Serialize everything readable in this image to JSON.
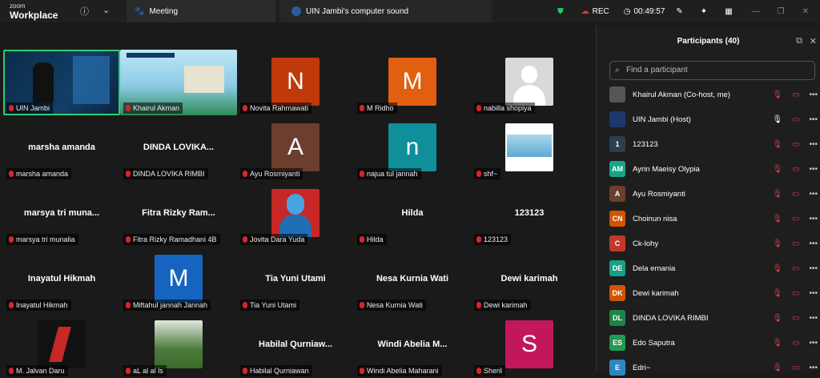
{
  "topbar": {
    "brand_small": "zoom",
    "brand_large": "Workplace",
    "meeting_tab": "Meeting",
    "sound_tab": "UIN Jambi's computer sound",
    "rec_label": "REC",
    "timer": "00:49:57"
  },
  "tiles": [
    {
      "name": "UIN Jambi",
      "type": "video",
      "label": "UIN Jambi"
    },
    {
      "name": "Khairul Akman",
      "type": "slide",
      "label": "Khairul Akman"
    },
    {
      "name": "Novita Rahmawati",
      "type": "avatar",
      "initial": "N",
      "color": "#c0390b",
      "label": "Novita Rahmawati"
    },
    {
      "name": "M Ridho",
      "type": "avatar",
      "initial": "M",
      "color": "#e06010",
      "label": "M Ridho"
    },
    {
      "name": "nabilla shopiya",
      "type": "photo",
      "label": "nabilla shopiya"
    },
    {
      "name": "marsha amanda",
      "type": "name",
      "label": "marsha amanda"
    },
    {
      "name": "DINDA LOVIKA...",
      "type": "name",
      "label": "DINDA LOVIKA RIMBI"
    },
    {
      "name": "Ayu Rosmiyanti",
      "type": "avatar",
      "initial": "A",
      "color": "#6b3e2e",
      "label": "Ayu Rosmiyanti"
    },
    {
      "name": "najua tul jannah",
      "type": "avatar",
      "initial": "n",
      "color": "#0e8f9a",
      "label": "najua tul jannah"
    },
    {
      "name": "shf~",
      "type": "slide2",
      "label": "shf~"
    },
    {
      "name": "marsya tri muna...",
      "type": "name",
      "label": "marsya tri munalia"
    },
    {
      "name": "Fitra Rizky Ram...",
      "type": "name",
      "label": "Fitra Rizky Ramadhani 4B"
    },
    {
      "name": "Jovita Dara Yuda",
      "type": "person",
      "label": "Jovita Dara Yuda"
    },
    {
      "name": "Hilda",
      "type": "name",
      "label": "Hilda"
    },
    {
      "name": "123123",
      "type": "name",
      "label": "123123"
    },
    {
      "name": "Inayatul Hikmah",
      "type": "name",
      "label": "Inayatul Hikmah"
    },
    {
      "name": "Miftahul jannah Jannah",
      "type": "avatar",
      "initial": "M",
      "color": "#1565c0",
      "label": "Miftahul jannah Jannah"
    },
    {
      "name": "Tia Yuni Utami",
      "type": "name",
      "label": "Tia Yuni Utami"
    },
    {
      "name": "Nesa Kurnia Wati",
      "type": "name",
      "label": "Nesa Kurnia Wati"
    },
    {
      "name": "Dewi karimah",
      "type": "name",
      "label": "Dewi karimah"
    },
    {
      "name": "M Jalvan Daru",
      "type": "logo",
      "label": "M. Jalvan Daru"
    },
    {
      "name": "photo",
      "type": "tree",
      "label": "aL al al ls"
    },
    {
      "name": "Habilal Qurniaw...",
      "type": "name",
      "label": "Habilal Qurniawan"
    },
    {
      "name": "Windi Abelia M...",
      "type": "name",
      "label": "Windi Abelia Maharani"
    },
    {
      "name": "Sheril",
      "type": "avatar",
      "initial": "S",
      "color": "#c2185b",
      "label": "Sheril"
    }
  ],
  "panel": {
    "title": "Participants (40)",
    "search_placeholder": "Find a participant",
    "participants": [
      {
        "initials": "",
        "name": "Khairul Akman (Co-host, me)",
        "color": "#555",
        "mic": "off"
      },
      {
        "initials": "",
        "name": "UIN Jambi (Host)",
        "color": "#1b3a6b",
        "mic": "on"
      },
      {
        "initials": "1",
        "name": "123123",
        "color": "#2c3e50",
        "mic": "off"
      },
      {
        "initials": "AM",
        "name": "Ayrin Maeisy Olypia",
        "color": "#17a589",
        "mic": "off"
      },
      {
        "initials": "A",
        "name": "Ayu Rosmiyanti",
        "color": "#6b3e2e",
        "mic": "off"
      },
      {
        "initials": "CN",
        "name": "Choinun nisa",
        "color": "#d35400",
        "mic": "off"
      },
      {
        "initials": "C",
        "name": "Ck-lohy",
        "color": "#c0392b",
        "mic": "off"
      },
      {
        "initials": "DE",
        "name": "Dela emania",
        "color": "#16a085",
        "mic": "off"
      },
      {
        "initials": "DK",
        "name": "Dewi karimah",
        "color": "#d35400",
        "mic": "off"
      },
      {
        "initials": "DL",
        "name": "DINDA LOVIKA RIMBI",
        "color": "#1e8449",
        "mic": "off"
      },
      {
        "initials": "ES",
        "name": "Edo Saputra",
        "color": "#229954",
        "mic": "off"
      },
      {
        "initials": "E",
        "name": "Edri~",
        "color": "#2e86c1",
        "mic": "off"
      }
    ]
  }
}
